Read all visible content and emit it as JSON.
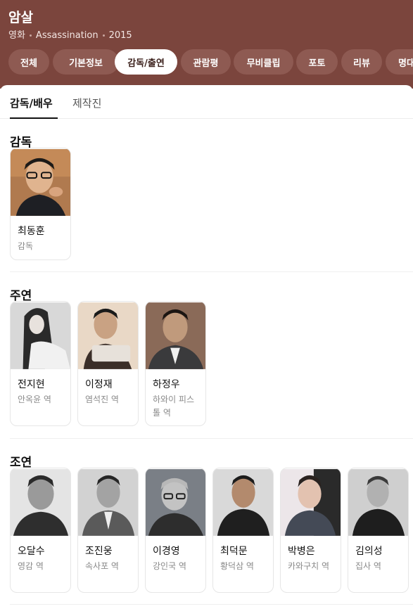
{
  "header": {
    "title": "암살",
    "meta": [
      "영화",
      "Assassination",
      "2015"
    ]
  },
  "tabs": [
    "전체",
    "기본정보",
    "감독/출연",
    "관람평",
    "무비클립",
    "포토",
    "리뷰",
    "명대"
  ],
  "active_tab": "감독/출연",
  "subtabs": [
    "감독/배우",
    "제작진"
  ],
  "sections": {
    "director": {
      "title": "감독",
      "people": [
        {
          "name": "최동훈",
          "role": "감독"
        }
      ]
    },
    "lead": {
      "title": "주연",
      "people": [
        {
          "name": "전지현",
          "role": "안옥윤 역"
        },
        {
          "name": "이정재",
          "role": "염석진 역"
        },
        {
          "name": "하정우",
          "role": "하와이 피스톨 역"
        }
      ]
    },
    "support": {
      "title": "조연",
      "people": [
        {
          "name": "오달수",
          "role": "영감 역"
        },
        {
          "name": "조진웅",
          "role": "속사포 역"
        },
        {
          "name": "이경영",
          "role": "강인국 역"
        },
        {
          "name": "최덕문",
          "role": "황덕삼 역"
        },
        {
          "name": "박병은",
          "role": "카와구치 역"
        },
        {
          "name": "김의성",
          "role": "집사 역"
        }
      ]
    }
  },
  "colors": {
    "header_bg": "#7b453d",
    "tab_bg": "#8e5a52",
    "tab_active_bg": "#ffffff"
  }
}
